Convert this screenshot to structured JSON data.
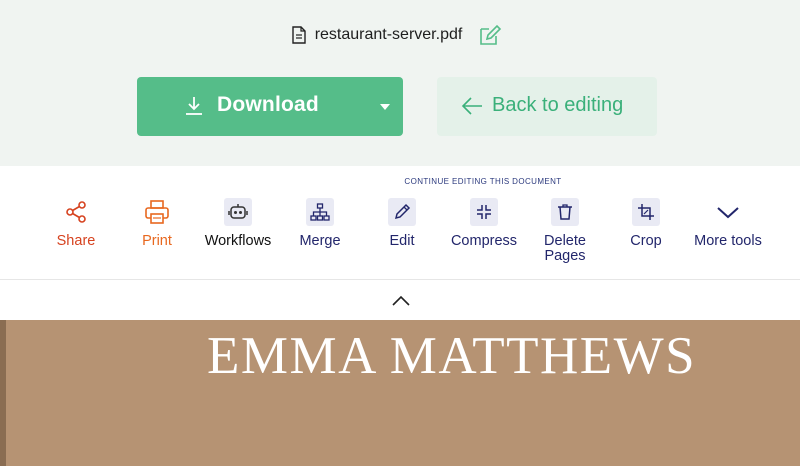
{
  "file": {
    "name": "restaurant-server.pdf"
  },
  "actions": {
    "download_label": "Download",
    "back_label": "Back to editing"
  },
  "toolbar": {
    "caption": "CONTINUE EDITING THIS DOCUMENT",
    "tools": [
      {
        "label": "Share",
        "icon": "share-icon",
        "color": "#d6421f"
      },
      {
        "label": "Print",
        "icon": "printer-icon",
        "color": "#e8681f"
      },
      {
        "label": "Workflows",
        "icon": "robot-icon",
        "color": "#111111"
      },
      {
        "label": "Merge",
        "icon": "merge-hierarchy-icon",
        "color": "#22266b"
      },
      {
        "label": "Edit",
        "icon": "pencil-icon",
        "color": "#22266b"
      },
      {
        "label": "Compress",
        "icon": "compress-arrows-icon",
        "color": "#22266b"
      },
      {
        "label": "Delete Pages",
        "icon": "trash-icon",
        "color": "#22266b"
      },
      {
        "label": "Crop",
        "icon": "crop-icon",
        "color": "#22266b"
      },
      {
        "label": "More tools",
        "icon": "chevron-down-icon",
        "color": "#22266b"
      }
    ]
  },
  "preview": {
    "name": "EMMA MATTHEWS"
  },
  "colors": {
    "accent": "#55bd89",
    "accent_light": "#e4f1e9",
    "nav": "#22266b",
    "share": "#d6421f",
    "print": "#e8681f",
    "resume_bg": "#b69373"
  }
}
